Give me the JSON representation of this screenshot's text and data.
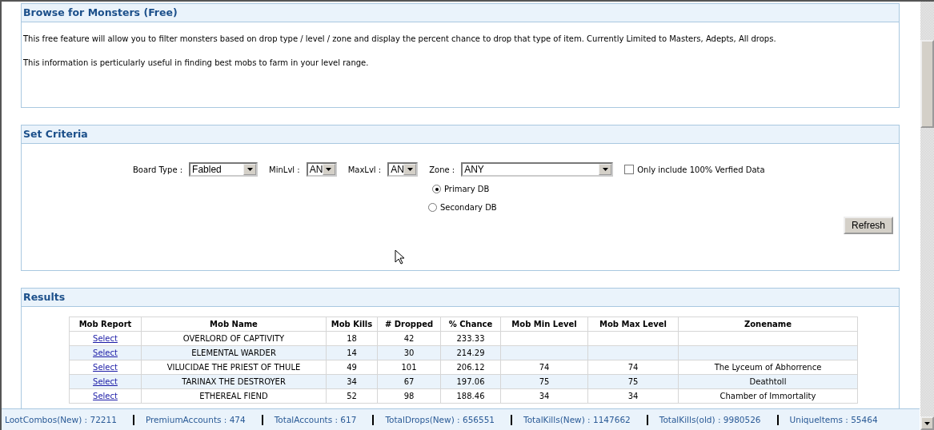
{
  "browse_panel": {
    "title": "Browse for Monsters (Free)",
    "paragraphs": [
      "This free feature will allow you to filter monsters based on drop type / level / zone and display the percent chance to drop that type of item. Currently Limited to Masters, Adepts, All drops.",
      "This information is perticularly useful in finding best mobs to farm in your level range."
    ]
  },
  "criteria_panel": {
    "title": "Set Criteria",
    "filters": [
      {
        "label": "Board Type :",
        "value": "Fabled"
      },
      {
        "label": "MinLvl :",
        "value": "AN"
      },
      {
        "label": "MaxLvl :",
        "value": "AN"
      },
      {
        "label": "Zone :",
        "value": "ANY"
      }
    ],
    "verified_checkbox": {
      "label": "Only include 100% Verfied Data",
      "checked": false
    },
    "databases": [
      {
        "label": "Primary DB",
        "selected": true
      },
      {
        "label": "Secondary DB",
        "selected": false
      }
    ],
    "refresh_button": "Refresh"
  },
  "results_panel": {
    "title": "Results",
    "table": {
      "columns": [
        "Mob Report",
        "Mob Name",
        "Mob Kills",
        "# Dropped",
        "% Chance",
        "Mob Min Level",
        "Mob Max Level",
        "Zonename"
      ],
      "rows": [
        [
          "Select",
          "OVERLORD OF CAPTIVITY",
          "18",
          "42",
          "233.33",
          "",
          "",
          ""
        ],
        [
          "Select",
          "ELEMENTAL WARDER",
          "14",
          "30",
          "214.29",
          "",
          "",
          ""
        ],
        [
          "Select",
          "VILUCIDAE THE PRIEST OF THULE",
          "49",
          "101",
          "206.12",
          "74",
          "74",
          "The Lyceum of Abhorrence"
        ],
        [
          "Select",
          "TARINAX THE DESTROYER",
          "34",
          "67",
          "197.06",
          "75",
          "75",
          "Deathtoll"
        ],
        [
          "Select",
          "ETHEREAL FIEND",
          "52",
          "98",
          "188.46",
          "34",
          "34",
          "Chamber of Immortality"
        ]
      ]
    }
  },
  "status_bar": [
    "LootCombos(New) : 72211",
    "PremiumAccounts : 474",
    "TotalAccounts : 617",
    "TotalDrops(New) : 656551",
    "TotalKills(New) : 1147662",
    "TotalKills(old) : 9980526",
    "UniqueItems : 55464"
  ]
}
